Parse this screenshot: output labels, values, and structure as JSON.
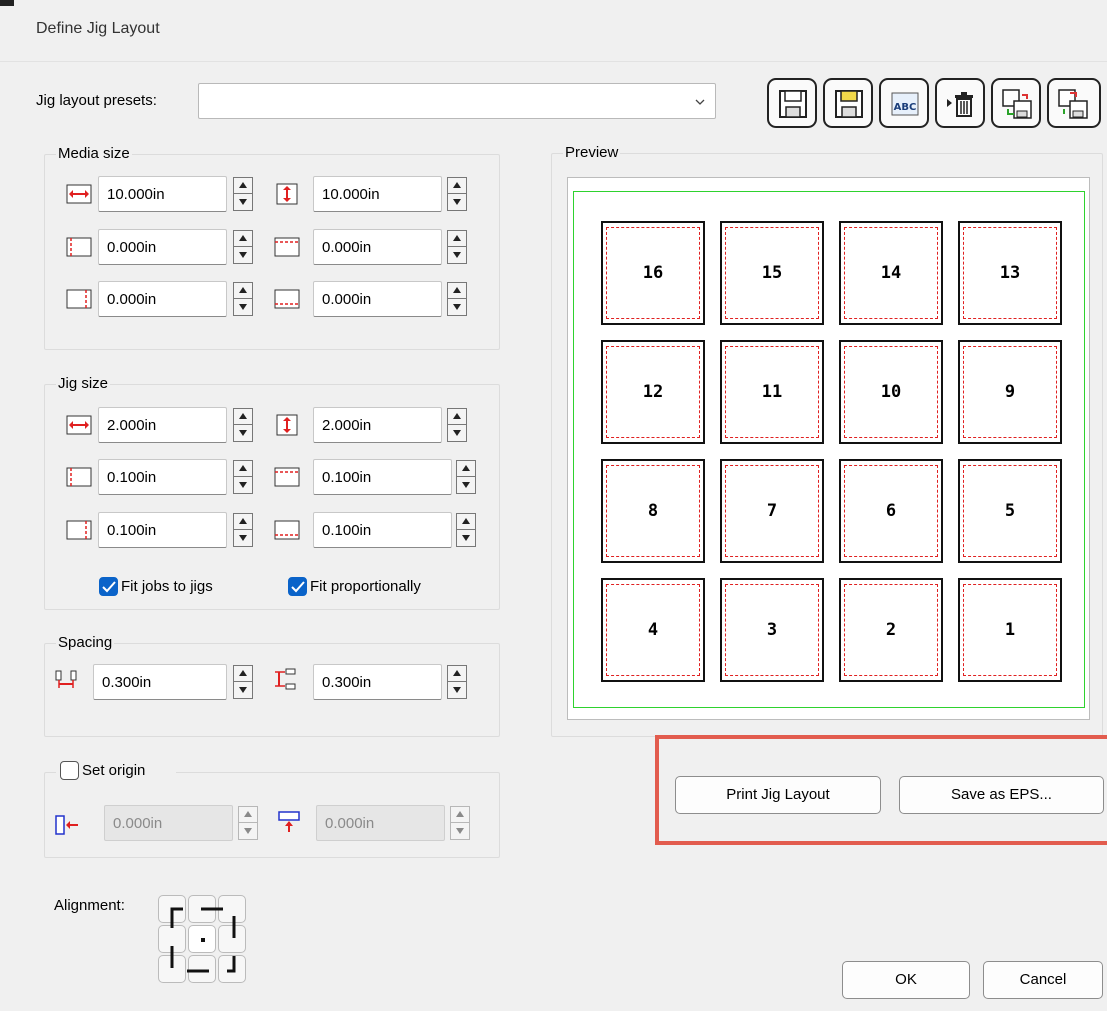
{
  "window": {
    "title": "Define Jig Layout"
  },
  "presets": {
    "label": "Jig layout presets:",
    "value": ""
  },
  "toolbar": {
    "buttons": [
      "save-preset-icon",
      "save-preset-as-icon",
      "rename-preset-icon",
      "delete-preset-icon",
      "import-preset-icon",
      "export-preset-icon"
    ]
  },
  "media_size": {
    "label": "Media size",
    "width": "10.000in",
    "height": "10.000in",
    "margin_left": "0.000in",
    "margin_top": "0.000in",
    "margin_right": "0.000in",
    "margin_bottom": "0.000in"
  },
  "jig_size": {
    "label": "Jig size",
    "width": "2.000in",
    "height": "2.000in",
    "margin_left": "0.100in",
    "margin_top": "0.100in",
    "margin_right": "0.100in",
    "margin_bottom": "0.100in",
    "fit_jobs_label": "Fit jobs to jigs",
    "fit_jobs_checked": true,
    "fit_prop_label": "Fit proportionally",
    "fit_prop_checked": true
  },
  "spacing": {
    "label": "Spacing",
    "horizontal": "0.300in",
    "vertical": "0.300in"
  },
  "origin": {
    "label": "Set origin",
    "checked": false,
    "x": "0.000in",
    "y": "0.000in"
  },
  "alignment": {
    "label": "Alignment:",
    "selected": "center"
  },
  "preview": {
    "label": "Preview",
    "jigs": [
      [
        "16",
        "15",
        "14",
        "13"
      ],
      [
        "12",
        "11",
        "10",
        "9"
      ],
      [
        "8",
        "7",
        "6",
        "5"
      ],
      [
        "4",
        "3",
        "2",
        "1"
      ]
    ]
  },
  "actions": {
    "print": "Print Jig Layout",
    "save_eps": "Save as EPS...",
    "ok": "OK",
    "cancel": "Cancel"
  },
  "colors": {
    "highlight": "#e25c4e",
    "preview_border": "#2ed22e",
    "jig_dash": "#e02020",
    "check": "#0a63c9"
  }
}
